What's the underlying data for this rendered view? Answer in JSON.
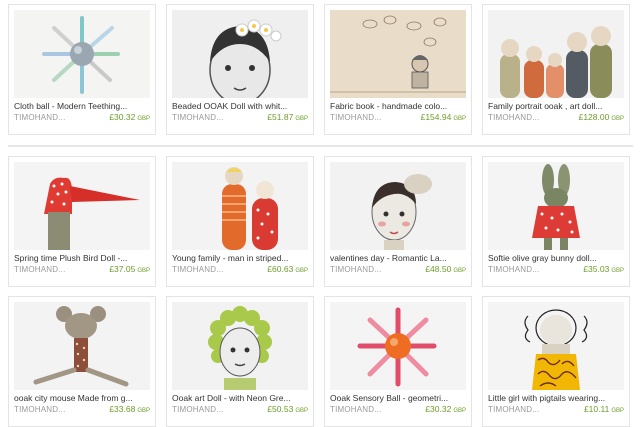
{
  "listings": [
    {
      "title": "Cloth ball - Modern Teething...",
      "shop": "TIMOHAND...",
      "price": "£30.32",
      "currency": "GBP"
    },
    {
      "title": "Beaded OOAK Doll with whit...",
      "shop": "TIMOHAND...",
      "price": "£51.87",
      "currency": "GBP"
    },
    {
      "title": "Fabric book - handmade colo...",
      "shop": "TIMOHAND...",
      "price": "£154.94",
      "currency": "GBP"
    },
    {
      "title": "Family portrait ooak , art doll...",
      "shop": "TIMOHAND...",
      "price": "£128.00",
      "currency": "GBP"
    },
    {
      "title": "Spring time Plush Bird Doll -...",
      "shop": "TIMOHAND...",
      "price": "£37.05",
      "currency": "GBP"
    },
    {
      "title": "Young family - man in striped...",
      "shop": "TIMOHAND...",
      "price": "£60.63",
      "currency": "GBP"
    },
    {
      "title": "valentines day - Romantic La...",
      "shop": "TIMOHAND...",
      "price": "£48.50",
      "currency": "GBP"
    },
    {
      "title": "Softie olive gray bunny doll...",
      "shop": "TIMOHAND...",
      "price": "£35.03",
      "currency": "GBP"
    },
    {
      "title": "ooak city mouse Made from g...",
      "shop": "TIMOHAND...",
      "price": "£33.68",
      "currency": "GBP"
    },
    {
      "title": "Ooak art Doll - with Neon Gre...",
      "shop": "TIMOHAND...",
      "price": "£50.53",
      "currency": "GBP"
    },
    {
      "title": "Ooak Sensory Ball - geometri...",
      "shop": "TIMOHAND...",
      "price": "£30.32",
      "currency": "GBP"
    },
    {
      "title": "Little girl with pigtails wearing...",
      "shop": "TIMOHAND...",
      "price": "£10.11",
      "currency": "GBP"
    }
  ],
  "colors": {
    "price": "#6b9e2a",
    "shop": "#999999",
    "title": "#333333",
    "border": "#e4e4e4"
  }
}
